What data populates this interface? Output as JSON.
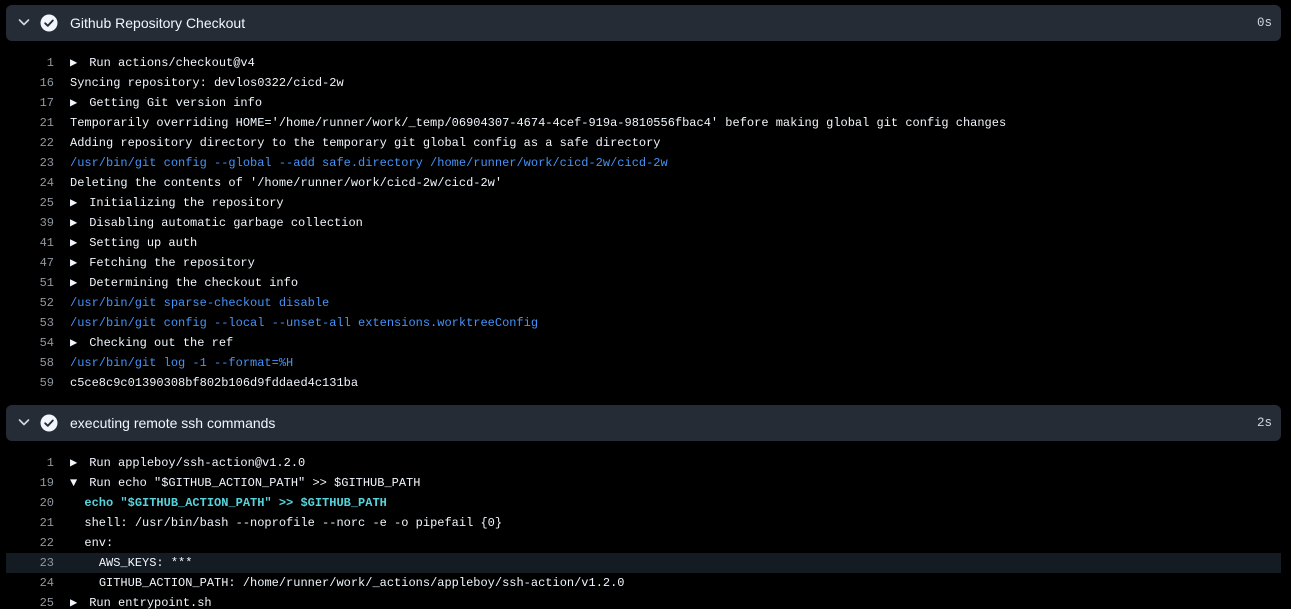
{
  "steps": [
    {
      "title": "Github Repository Checkout",
      "duration": "0s",
      "lines": [
        {
          "n": "1",
          "text": "Run actions/checkout@v4",
          "marker": "▶",
          "style": "normal",
          "indent": ""
        },
        {
          "n": "16",
          "text": "Syncing repository: devlos0322/cicd-2w",
          "marker": "",
          "style": "normal",
          "indent": ""
        },
        {
          "n": "17",
          "text": "Getting Git version info",
          "marker": "▶",
          "style": "normal",
          "indent": ""
        },
        {
          "n": "21",
          "text": "Temporarily overriding HOME='/home/runner/work/_temp/06904307-4674-4cef-919a-9810556fbac4' before making global git config changes",
          "marker": "",
          "style": "normal",
          "indent": ""
        },
        {
          "n": "22",
          "text": "Adding repository directory to the temporary git global config as a safe directory",
          "marker": "",
          "style": "normal",
          "indent": ""
        },
        {
          "n": "23",
          "text": "/usr/bin/git config --global --add safe.directory /home/runner/work/cicd-2w/cicd-2w",
          "marker": "",
          "style": "cmd",
          "indent": ""
        },
        {
          "n": "24",
          "text": "Deleting the contents of '/home/runner/work/cicd-2w/cicd-2w'",
          "marker": "",
          "style": "normal",
          "indent": ""
        },
        {
          "n": "25",
          "text": "Initializing the repository",
          "marker": "▶",
          "style": "normal",
          "indent": ""
        },
        {
          "n": "39",
          "text": "Disabling automatic garbage collection",
          "marker": "▶",
          "style": "normal",
          "indent": ""
        },
        {
          "n": "41",
          "text": "Setting up auth",
          "marker": "▶",
          "style": "normal",
          "indent": ""
        },
        {
          "n": "47",
          "text": "Fetching the repository",
          "marker": "▶",
          "style": "normal",
          "indent": ""
        },
        {
          "n": "51",
          "text": "Determining the checkout info",
          "marker": "▶",
          "style": "normal",
          "indent": ""
        },
        {
          "n": "52",
          "text": "/usr/bin/git sparse-checkout disable",
          "marker": "",
          "style": "cmd",
          "indent": ""
        },
        {
          "n": "53",
          "text": "/usr/bin/git config --local --unset-all extensions.worktreeConfig",
          "marker": "",
          "style": "cmd",
          "indent": ""
        },
        {
          "n": "54",
          "text": "Checking out the ref",
          "marker": "▶",
          "style": "normal",
          "indent": ""
        },
        {
          "n": "58",
          "text": "/usr/bin/git log -1 --format=%H",
          "marker": "",
          "style": "cmd",
          "indent": ""
        },
        {
          "n": "59",
          "text": "c5ce8c9c01390308bf802b106d9fddaed4c131ba",
          "marker": "",
          "style": "normal",
          "indent": ""
        }
      ]
    },
    {
      "title": "executing remote ssh commands",
      "duration": "2s",
      "lines": [
        {
          "n": "1",
          "text": "Run appleboy/ssh-action@v1.2.0",
          "marker": "▶",
          "style": "normal",
          "indent": ""
        },
        {
          "n": "19",
          "text": "Run echo \"$GITHUB_ACTION_PATH\" >> $GITHUB_PATH",
          "marker": "▼",
          "style": "normal",
          "indent": ""
        },
        {
          "n": "20",
          "text": "echo \"$GITHUB_ACTION_PATH\" >> $GITHUB_PATH",
          "marker": "",
          "style": "cmd-bold",
          "indent": "  "
        },
        {
          "n": "21",
          "text": "shell: /usr/bin/bash --noprofile --norc -e -o pipefail {0}",
          "marker": "",
          "style": "normal",
          "indent": "  "
        },
        {
          "n": "22",
          "text": "env:",
          "marker": "",
          "style": "normal",
          "indent": "  "
        },
        {
          "n": "23",
          "text": "AWS_KEYS: ***",
          "marker": "",
          "style": "normal",
          "indent": "    ",
          "highlight": true
        },
        {
          "n": "24",
          "text": "GITHUB_ACTION_PATH: /home/runner/work/_actions/appleboy/ssh-action/v1.2.0",
          "marker": "",
          "style": "normal",
          "indent": "    "
        },
        {
          "n": "25",
          "text": "Run entrypoint.sh",
          "marker": "▶",
          "style": "normal",
          "indent": ""
        }
      ]
    }
  ],
  "icons": {
    "chevron": "chevron-down-icon",
    "check": "check-circle-icon"
  },
  "colors": {
    "header_bg": "#262c36",
    "command": "#4493f8",
    "command_bold": "#56d4dd",
    "line_number": "#9198a1",
    "text": "#f0f6fc"
  }
}
